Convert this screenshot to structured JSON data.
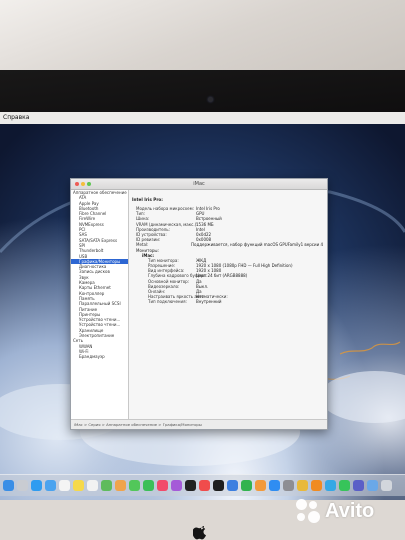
{
  "menubar": {
    "label": "Справка"
  },
  "window": {
    "title": "iMac",
    "sidebar": {
      "items": [
        {
          "label": "Аппаратное обеспечение",
          "level": 0,
          "selected": false
        },
        {
          "label": "ATA",
          "level": 1,
          "selected": false
        },
        {
          "label": "Apple Pay",
          "level": 1,
          "selected": false
        },
        {
          "label": "Bluetooth",
          "level": 1,
          "selected": false
        },
        {
          "label": "Fibre Channel",
          "level": 1,
          "selected": false
        },
        {
          "label": "FireWire",
          "level": 1,
          "selected": false
        },
        {
          "label": "NVMExpress",
          "level": 1,
          "selected": false
        },
        {
          "label": "PCI",
          "level": 1,
          "selected": false
        },
        {
          "label": "SAS",
          "level": 1,
          "selected": false
        },
        {
          "label": "SATA/SATA Express",
          "level": 1,
          "selected": false
        },
        {
          "label": "SPI",
          "level": 1,
          "selected": false
        },
        {
          "label": "Thunderbolt",
          "level": 1,
          "selected": false
        },
        {
          "label": "USB",
          "level": 1,
          "selected": false
        },
        {
          "label": "Графика/Мониторы",
          "level": 1,
          "selected": true
        },
        {
          "label": "Диагностика",
          "level": 1,
          "selected": false
        },
        {
          "label": "Запись дисков",
          "level": 1,
          "selected": false
        },
        {
          "label": "Звук",
          "level": 1,
          "selected": false
        },
        {
          "label": "Камера",
          "level": 1,
          "selected": false
        },
        {
          "label": "Карты Ethernet",
          "level": 1,
          "selected": false
        },
        {
          "label": "Контроллер",
          "level": 1,
          "selected": false
        },
        {
          "label": "Память",
          "level": 1,
          "selected": false
        },
        {
          "label": "Параллельный SCSI",
          "level": 1,
          "selected": false
        },
        {
          "label": "Питание",
          "level": 1,
          "selected": false
        },
        {
          "label": "Принтеры",
          "level": 1,
          "selected": false
        },
        {
          "label": "Устройство чтени...",
          "level": 1,
          "selected": false
        },
        {
          "label": "Устройство чтени...",
          "level": 1,
          "selected": false
        },
        {
          "label": "Хранилище",
          "level": 1,
          "selected": false
        },
        {
          "label": "Электропитание",
          "level": 1,
          "selected": false
        },
        {
          "label": "Сеть",
          "level": 0,
          "selected": false
        },
        {
          "label": "WWAN",
          "level": 1,
          "selected": false
        },
        {
          "label": "Wi-Fi",
          "level": 1,
          "selected": false
        },
        {
          "label": "Брандмауэр",
          "level": 1,
          "selected": false
        }
      ]
    },
    "content": {
      "gpu_name": "Intel Iris Pro:",
      "properties": [
        {
          "key": "Модель набора микросхем:",
          "value": "Intel Iris Pro"
        },
        {
          "key": "Тип:",
          "value": "GPU"
        },
        {
          "key": "Шина:",
          "value": "Встроенный"
        },
        {
          "key": "VRAM (динамическая, макс.):",
          "value": "1536 МБ"
        },
        {
          "key": "Производитель:",
          "value": "Intel"
        },
        {
          "key": "ID устройства:",
          "value": "0x0d22"
        },
        {
          "key": "ID ревизии:",
          "value": "0x0008"
        },
        {
          "key": "Metal:",
          "value": "Поддерживается, набор функций macOS GPUFamily1 версии 4"
        }
      ],
      "monitors_label": "Мониторы:",
      "monitor_name": "iMac:",
      "monitor_properties": [
        {
          "key": "Тип монитора:",
          "value": "ЖКД"
        },
        {
          "key": "Разрешение:",
          "value": "1920 x 1080 (1080p FHD — Full High Definition)"
        },
        {
          "key": "Вид интерфейса:",
          "value": "1920 x 1080"
        },
        {
          "key": "Глубина кадрового буфера:",
          "value": "Цвет 24 бит (ARGB8888)"
        },
        {
          "key": "Основной монитор:",
          "value": "Да"
        },
        {
          "key": "Видеозеркало:",
          "value": "Выкл."
        },
        {
          "key": "Онлайн:",
          "value": "Да"
        },
        {
          "key": "Настраивать яркость автоматически:",
          "value": "Нет"
        },
        {
          "key": "Тип подключения:",
          "value": "Внутренний"
        }
      ]
    },
    "statusbar": "iMac > Серия > Аппаратное обеспечение > Графика/Мониторы"
  },
  "dock": {
    "icons": [
      {
        "name": "finder-icon",
        "color": "#3a8ee6"
      },
      {
        "name": "launchpad-icon",
        "color": "#c9ccd2"
      },
      {
        "name": "safari-icon",
        "color": "#2f9cf0"
      },
      {
        "name": "mail-icon",
        "color": "#4aa3ef"
      },
      {
        "name": "calendar-icon",
        "color": "#f4f4f4"
      },
      {
        "name": "notes-icon",
        "color": "#f6d94b"
      },
      {
        "name": "reminders-icon",
        "color": "#f2f2f2"
      },
      {
        "name": "maps-icon",
        "color": "#5fbb5d"
      },
      {
        "name": "photos-icon",
        "color": "#f0a44c"
      },
      {
        "name": "messages-icon",
        "color": "#52c75a"
      },
      {
        "name": "facetime-icon",
        "color": "#3cbf59"
      },
      {
        "name": "music-icon",
        "color": "#f24b6a"
      },
      {
        "name": "podcasts-icon",
        "color": "#a55bd8"
      },
      {
        "name": "tv-icon",
        "color": "#222222"
      },
      {
        "name": "news-icon",
        "color": "#f04c4c"
      },
      {
        "name": "stocks-icon",
        "color": "#1e1e1e"
      },
      {
        "name": "keynote-icon",
        "color": "#3d7fe0"
      },
      {
        "name": "numbers-icon",
        "color": "#33b34f"
      },
      {
        "name": "pages-icon",
        "color": "#f29a3b"
      },
      {
        "name": "app-store-icon",
        "color": "#2f8df2"
      },
      {
        "name": "settings-icon",
        "color": "#8e8e93"
      },
      {
        "name": "chrome-icon",
        "color": "#e9b93b"
      },
      {
        "name": "vlc-icon",
        "color": "#f08b21"
      },
      {
        "name": "telegram-icon",
        "color": "#34a8e5"
      },
      {
        "name": "whatsapp-icon",
        "color": "#37c45a"
      },
      {
        "name": "teams-icon",
        "color": "#5b5fc7"
      },
      {
        "name": "folder-icon",
        "color": "#6aa8e8"
      },
      {
        "name": "trash-icon",
        "color": "#d2d6dc"
      }
    ]
  },
  "watermark": {
    "text": "Avito"
  }
}
